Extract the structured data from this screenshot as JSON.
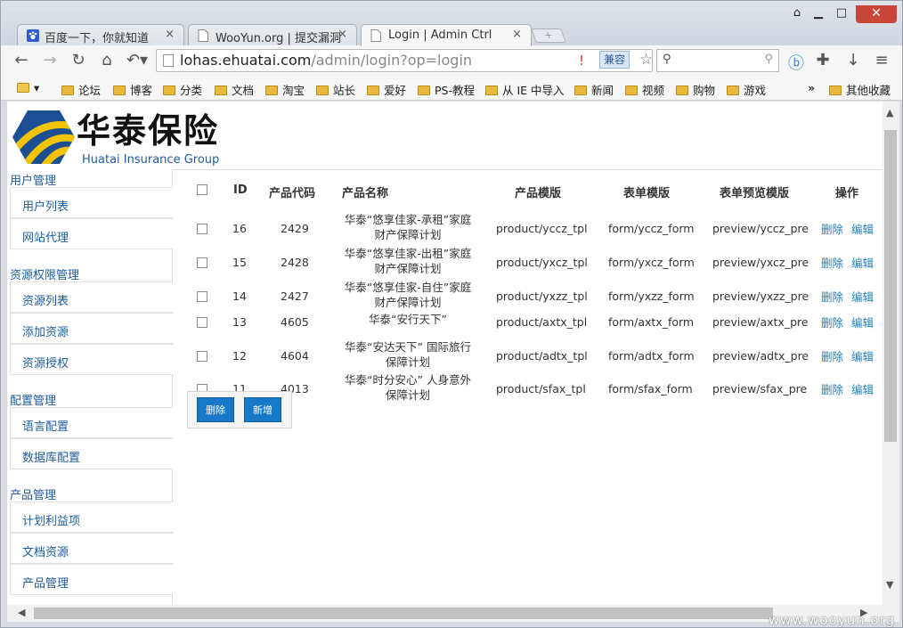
{
  "tabs": [
    {
      "title": "百度一下，你就知道",
      "icon": "baidu-paw-icon"
    },
    {
      "title": "WooYun.org | 提交漏洞",
      "icon": "page-icon"
    },
    {
      "title": "Login | Admin Ctrl",
      "icon": "page-icon"
    }
  ],
  "toolbar": {
    "url_host": "lohas.ehuatai.com",
    "url_path": "/admin/login?op=login",
    "compat_label": "兼容"
  },
  "bookmarks": [
    "论坛",
    "博客",
    "分类",
    "文档",
    "淘宝",
    "站长",
    "爱好",
    "PS-教程",
    "从 IE 中导入",
    "新闻",
    "视频",
    "购物",
    "游戏"
  ],
  "bookmarks_more": "»",
  "bookmarks_other": "其他收藏",
  "brand": {
    "cn": "华泰保险",
    "en": "Huatai Insurance Group"
  },
  "sidebar": [
    {
      "title": "用户管理",
      "items": [
        "用户列表",
        "网站代理"
      ]
    },
    {
      "title": "资源权限管理",
      "items": [
        "资源列表",
        "添加资源",
        "资源授权"
      ]
    },
    {
      "title": "配置管理",
      "items": [
        "语言配置",
        "数据库配置"
      ]
    },
    {
      "title": "产品管理",
      "items": [
        "计划利益项",
        "文档资源",
        "产品管理"
      ]
    }
  ],
  "table": {
    "headers": [
      "ID",
      "产品代码",
      "产品名称",
      "产品模版",
      "表单模版",
      "表单预览模版",
      "操作"
    ],
    "rows": [
      {
        "id": "16",
        "code": "2429",
        "name1": "华泰“悠享佳家-承租”家庭",
        "name2": "财产保障计划",
        "product": "product/yccz_tpl",
        "form": "form/yccz_form",
        "preview": "preview/yccz_pre"
      },
      {
        "id": "15",
        "code": "2428",
        "name1": "华泰“悠享佳家-出租”家庭",
        "name2": "财产保障计划",
        "product": "product/yxcz_tpl",
        "form": "form/yxcz_form",
        "preview": "preview/yxcz_pre"
      },
      {
        "id": "14",
        "code": "2427",
        "name1": "华泰“悠享佳家-自住”家庭",
        "name2": "财产保障计划",
        "product": "product/yxzz_tpl",
        "form": "form/yxzz_form",
        "preview": "preview/yxzz_pre"
      },
      {
        "id": "13",
        "code": "4605",
        "name1": "华泰“安行天下”",
        "name2": "",
        "product": "product/axtx_tpl",
        "form": "form/axtx_form",
        "preview": "preview/axtx_pre"
      },
      {
        "id": "12",
        "code": "4604",
        "name1": "华泰“安达天下” 国际旅行",
        "name2": "保障计划",
        "product": "product/adtx_tpl",
        "form": "form/adtx_form",
        "preview": "preview/adtx_pre"
      },
      {
        "id": "11",
        "code": "4013",
        "name1": "华泰“时分安心” 人身意外",
        "name2": "保障计划",
        "product": "product/sfax_tpl",
        "form": "form/sfax_form",
        "preview": "preview/sfax_pre"
      }
    ],
    "action_delete": "删除",
    "action_edit": "编辑"
  },
  "buttons": {
    "delete": "删除",
    "add": "新增"
  },
  "watermark": "www.wooyun.org",
  "colors": {
    "link": "#1d7fc0",
    "button": "#1879c8",
    "brand_blue": "#1d5d9f",
    "brand_yellow": "#f2c400"
  }
}
